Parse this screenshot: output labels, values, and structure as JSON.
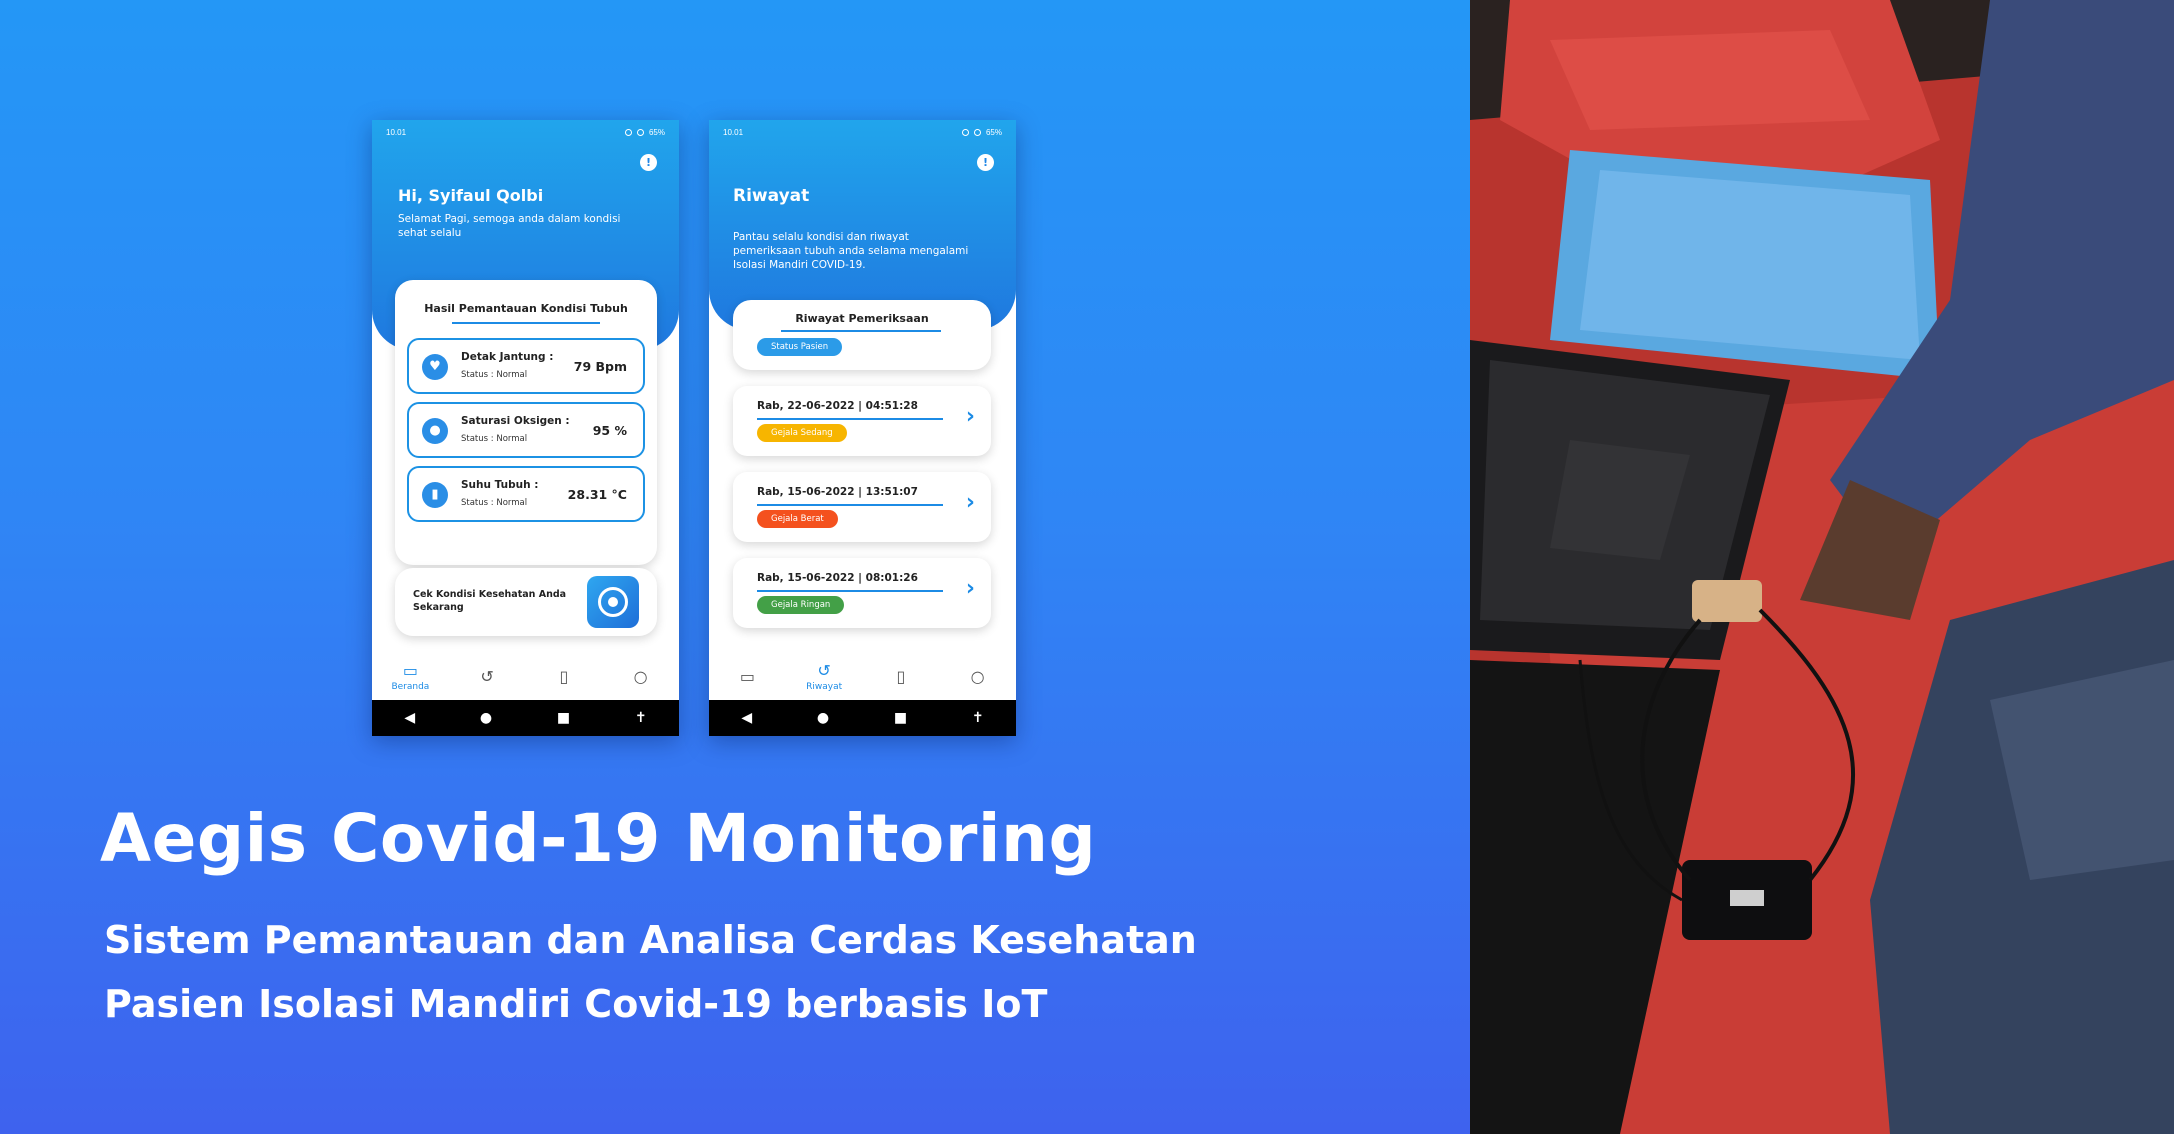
{
  "headline": {
    "title": "Aegis Covid-19 Monitoring",
    "subtitle_line1": "Sistem Pemantauan dan Analisa Cerdas Kesehatan",
    "subtitle_line2": "Pasien Isolasi Mandiri Covid-19 berbasis IoT"
  },
  "status_bar": {
    "time": "10.01",
    "battery": "65%"
  },
  "home": {
    "greeting": "Hi, Syifaul Qolbi",
    "subtext": "Selamat Pagi, semoga anda dalam kondisi sehat selalu",
    "card_title": "Hasil Pemantauan Kondisi Tubuh",
    "metrics": [
      {
        "label": "Detak Jantung :",
        "status": "Status : Normal",
        "value": "79 Bpm",
        "icon": "heart-pulse-icon"
      },
      {
        "label": "Saturasi Oksigen :",
        "status": "Status : Normal",
        "value": "95 %",
        "icon": "droplet-icon"
      },
      {
        "label": "Suhu Tubuh :",
        "status": "Status : Normal",
        "value": "28.31 °C",
        "icon": "thermometer-icon"
      }
    ],
    "check_text": "Cek Kondisi Kesehatan Anda Sekarang"
  },
  "nav": {
    "home_label": "Beranda",
    "history_label": "Riwayat"
  },
  "history": {
    "title": "Riwayat",
    "subtext": "Pantau selalu kondisi dan riwayat pemeriksaan tubuh anda selama mengalami Isolasi Mandiri COVID-19.",
    "card_title": "Riwayat Pemeriksaan",
    "status_label": "Status Pasien",
    "items": [
      {
        "date": "Rab, 22-06-2022 | 04:51:28",
        "status": "Gejala Sedang",
        "color": "#f7b500"
      },
      {
        "date": "Rab, 15-06-2022 | 13:51:07",
        "status": "Gejala Berat",
        "color": "#f4511e"
      },
      {
        "date": "Rab, 15-06-2022 | 08:01:26",
        "status": "Gejala Ringan",
        "color": "#43a047"
      }
    ]
  },
  "colors": {
    "accent": "#1c8be5",
    "brand_gradient_top": "#2497f6",
    "brand_gradient_bottom": "#3e62ee"
  }
}
